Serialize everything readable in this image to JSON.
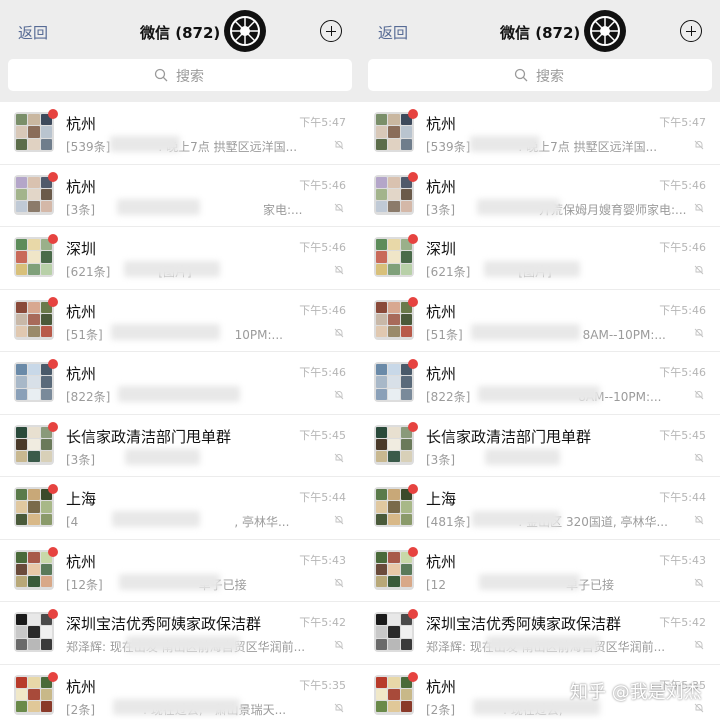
{
  "header": {
    "back_label": "返回",
    "title": "微信 (872)",
    "logo_icon": "wheel-logo-icon",
    "add_icon": "plus-circle-icon"
  },
  "search": {
    "placeholder": "搜索"
  },
  "left": {
    "rows": [
      {
        "name": "杭州",
        "preview": "[539条]　　　　: 晚上7点 拱墅区远洋国...",
        "time": "下午5:47"
      },
      {
        "name": "杭州",
        "preview": "[3条]　　　　　　　　　　　　　　家电:...",
        "time": "下午5:46"
      },
      {
        "name": "深圳",
        "preview": "[621条]　　　　[图片]",
        "time": "下午5:46"
      },
      {
        "name": "杭州",
        "preview": "[51条]　　　　　　　　　　　10PM:...",
        "time": "下午5:46"
      },
      {
        "name": "杭州",
        "preview": "[822条]　　　　　　　　　　　　　　",
        "time": "下午5:46"
      },
      {
        "name": "长信家政清洁部门甩单群",
        "preview": "[3条]",
        "time": "下午5:45"
      },
      {
        "name": "上海",
        "preview": "[4　　　　　　　　　　　　　, 亭林华...",
        "time": "下午5:44"
      },
      {
        "name": "杭州",
        "preview": "[12条]　　　　　　　　单子已接",
        "time": "下午5:43"
      },
      {
        "name": "深圳宝洁优秀阿姨家政保洁群",
        "preview": "郑泽辉: 现在出发 南山区前海自贸区华润前...",
        "time": "下午5:42"
      },
      {
        "name": "杭州",
        "preview": "[2条]　　　　: 现在过去,　萧山景瑞天...",
        "time": "下午5:35"
      }
    ]
  },
  "right": {
    "rows": [
      {
        "name": "杭州",
        "preview": "[539条]　　　　: 晚上7点 拱墅区远洋国...",
        "time": "下午5:47"
      },
      {
        "name": "杭州",
        "preview": "[3条]　　　　　　　开荒保姆月嫂育婴师家电:...",
        "time": "下午5:46"
      },
      {
        "name": "深圳",
        "preview": "[621条]　　　　[图片]",
        "time": "下午5:46"
      },
      {
        "name": "杭州",
        "preview": "[51条]　　　　　　　　　　8AM--10PM:...",
        "time": "下午5:46"
      },
      {
        "name": "杭州",
        "preview": "[822条]　　　　　　　　　8AM--10PM:...",
        "time": "下午5:46"
      },
      {
        "name": "长信家政清洁部门甩单群",
        "preview": "[3条]",
        "time": "下午5:45"
      },
      {
        "name": "上海",
        "preview": "[481条]　　　　: 金山区 320国道, 亭林华...",
        "time": "下午5:44"
      },
      {
        "name": "杭州",
        "preview": "[12　　　　　　　　　　单子已接",
        "time": "下午5:43"
      },
      {
        "name": "深圳宝洁优秀阿姨家政保洁群",
        "preview": "郑泽辉: 现在出发 南山区前海自贸区华润前...",
        "time": "下午5:42"
      },
      {
        "name": "杭州",
        "preview": "[2条]　　　　: 现在过去,",
        "time": "下午5:35"
      }
    ]
  },
  "watermark": "知乎 @我是刘杰",
  "colors": {
    "accent": "#576b95",
    "badge": "#e64340",
    "header_bg": "#ededed"
  }
}
